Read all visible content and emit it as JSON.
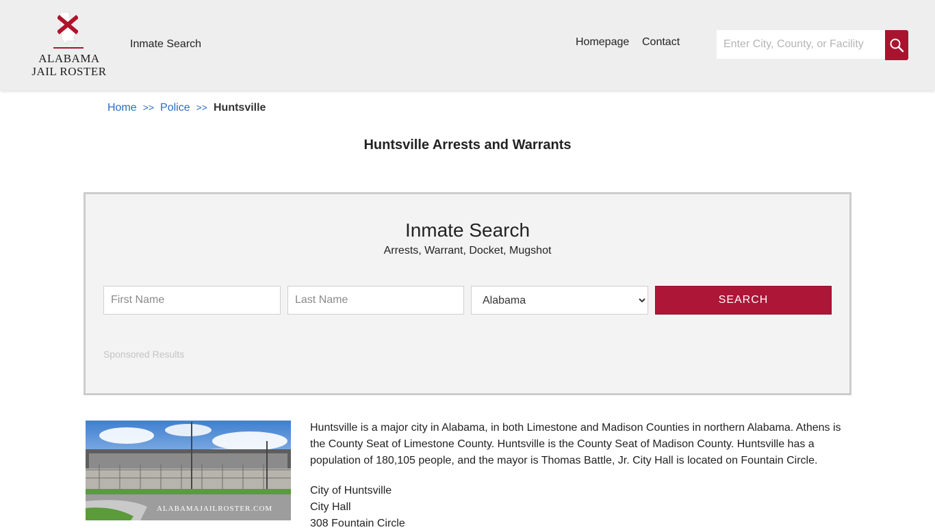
{
  "header": {
    "logo": {
      "line1": "ALABAMA",
      "line2": "JAIL ROSTER",
      "emblem_icon": "alabama-state-flag-icon",
      "brand_color": "#a8142e"
    },
    "nav_inmate_search": "Inmate Search",
    "nav_homepage": "Homepage",
    "nav_contact": "Contact",
    "search_placeholder": "Enter City, County, or Facility",
    "search_icon": "search-icon"
  },
  "breadcrumb": {
    "items": [
      "Home",
      "Police"
    ],
    "separator": ">>",
    "current": "Huntsville"
  },
  "page_title": "Huntsville Arrests and Warrants",
  "search_panel": {
    "title": "Inmate Search",
    "subtitle": "Arrests, Warrant, Docket, Mugshot",
    "first_name_placeholder": "First Name",
    "last_name_placeholder": "Last Name",
    "state_selected": "Alabama",
    "button_label": "SEARCH",
    "sponsored": "Sponsored Results",
    "button_color": "#ad1637"
  },
  "content": {
    "photo_watermark": "ALABAMAJAILROSTER.COM",
    "description": "Huntsville is a major city in Alabama, in both Limestone and Madison Counties in northern Alabama. Athens is the County Seat of Limestone County. Huntsville is the County Seat of Madison County. Huntsville has a population of 180,105 people, and the mayor is Thomas Battle, Jr. City Hall is located on Fountain Circle.",
    "address_line1": "City of Huntsville",
    "address_line2": "City Hall",
    "address_line3": "308 Fountain Circle"
  }
}
